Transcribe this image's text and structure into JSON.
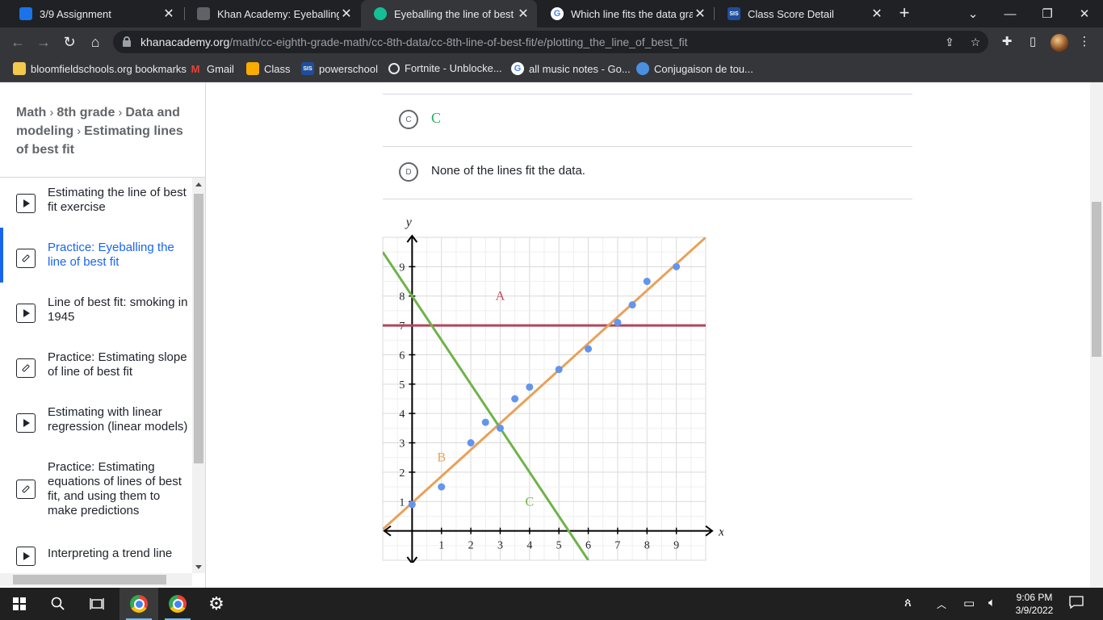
{
  "browser": {
    "tabs": [
      {
        "title": "3/9 Assignment",
        "favicon": "google-classroom-icon",
        "color": "#1e8e3e"
      },
      {
        "title": "Khan Academy: Eyeballing th",
        "favicon": "classroom-assignment-icon",
        "color": "#5f6368"
      },
      {
        "title": "Eyeballing the line of best fit",
        "favicon": "khan-academy-icon",
        "color": "#14bf96"
      },
      {
        "title": "Which line fits the data grapl",
        "favicon": "google-icon",
        "color": "#4285f4"
      },
      {
        "title": "Class Score Detail",
        "favicon": "sis-icon",
        "color": "#1f4e9c",
        "badge": "SIS"
      }
    ],
    "url_host": "khanacademy.org",
    "url_path": "/math/cc-eighth-grade-math/cc-8th-data/cc-8th-line-of-best-fit/e/plotting_the_line_of_best_fit",
    "bookmarks": [
      {
        "label": "bloomfieldschools.org bookmarks",
        "icon": "folder-icon",
        "color": "#f2c94c"
      },
      {
        "label": "Gmail",
        "icon": "gmail-icon",
        "color": "#ea4335"
      },
      {
        "label": "Class",
        "icon": "google-classroom-icon",
        "color": "#f9ab00"
      },
      {
        "label": "powerschool",
        "icon": "sis-icon",
        "color": "#1f4e9c",
        "badge": "SIS"
      },
      {
        "label": "Fortnite - Unblocke...",
        "icon": "globe-icon",
        "color": "#e8eaed"
      },
      {
        "label": "all music notes - Go...",
        "icon": "google-icon",
        "color": "#4285f4"
      },
      {
        "label": "Conjugaison de tou...",
        "icon": "conjugaison-icon",
        "color": "#4a90e2"
      }
    ]
  },
  "sidebar": {
    "breadcrumb": [
      "Math",
      "8th grade",
      "Data and modeling",
      "Estimating lines of best fit"
    ],
    "breadcrumb_sep": "›",
    "lessons": [
      {
        "title": "Estimating the line of best fit exercise",
        "type": "video",
        "active": false
      },
      {
        "title": "Practice: Eyeballing the line of best fit",
        "type": "exercise",
        "active": true
      },
      {
        "title": "Line of best fit: smoking in 1945",
        "type": "video",
        "active": false
      },
      {
        "title": "Practice: Estimating slope of line of best fit",
        "type": "exercise",
        "active": false
      },
      {
        "title": "Estimating with linear regression (linear models)",
        "type": "video",
        "active": false
      },
      {
        "title": "Practice: Estimating equations of lines of best fit, and using them to make predictions",
        "type": "exercise",
        "active": false
      },
      {
        "title": "Interpreting a trend line",
        "type": "video",
        "active": false
      }
    ]
  },
  "question": {
    "choices": [
      {
        "letter": "C",
        "text": "C",
        "math": true
      },
      {
        "letter": "D",
        "text": "None of the lines fit the data.",
        "math": false
      }
    ]
  },
  "chart_data": {
    "type": "scatter",
    "xlabel": "x",
    "ylabel": "y",
    "xlim": [
      -1,
      10
    ],
    "ylim": [
      -1,
      10
    ],
    "xticks": [
      1,
      2,
      3,
      4,
      5,
      6,
      7,
      8,
      9
    ],
    "yticks": [
      1,
      2,
      3,
      4,
      5,
      6,
      7,
      8,
      9
    ],
    "grid": true,
    "points": [
      {
        "x": 0,
        "y": 0.9
      },
      {
        "x": 1,
        "y": 1.5
      },
      {
        "x": 2,
        "y": 3
      },
      {
        "x": 2.5,
        "y": 3.7
      },
      {
        "x": 3,
        "y": 3.5
      },
      {
        "x": 3.5,
        "y": 4.5
      },
      {
        "x": 4,
        "y": 4.9
      },
      {
        "x": 5,
        "y": 5.5
      },
      {
        "x": 6,
        "y": 6.2
      },
      {
        "x": 7,
        "y": 7.1
      },
      {
        "x": 7.5,
        "y": 7.7
      },
      {
        "x": 8,
        "y": 8.5
      },
      {
        "x": 9,
        "y": 9
      }
    ],
    "point_color": "#6495ed",
    "lines": [
      {
        "label": "A",
        "color": "#b5445a",
        "from": [
          -1,
          7
        ],
        "to": [
          10,
          7
        ],
        "label_at": [
          3,
          8
        ]
      },
      {
        "label": "B",
        "color": "#e8a15a",
        "from": [
          -1,
          0.05
        ],
        "to": [
          10,
          10
        ],
        "label_at": [
          1,
          2.5
        ]
      },
      {
        "label": "C",
        "color": "#6fb34a",
        "from": [
          -1,
          9.5
        ],
        "to": [
          6,
          -1
        ],
        "label_at": [
          4,
          1
        ]
      }
    ]
  },
  "taskbar": {
    "time": "9:06 PM",
    "date": "3/9/2022"
  }
}
